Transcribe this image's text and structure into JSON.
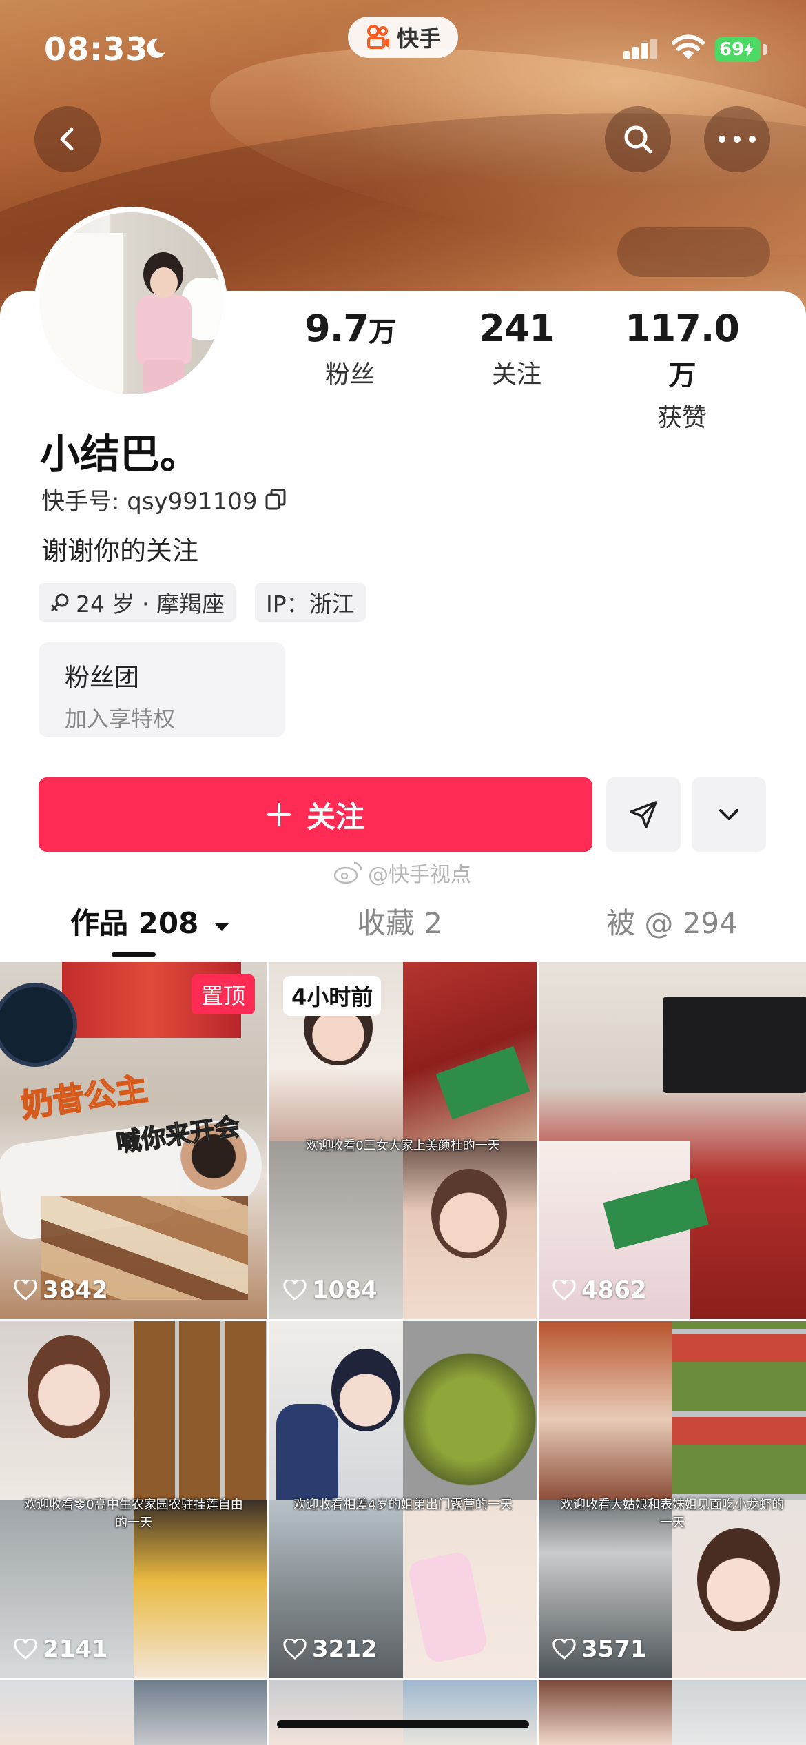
{
  "status_bar": {
    "time": "08:33",
    "app_name": "快手",
    "battery": "69"
  },
  "profile": {
    "name": "小结巴。",
    "kuaishou_id": "快手号: qsy991109",
    "bio": "谢谢你的关注",
    "tags": [
      "24 岁 · 摩羯座",
      "IP：浙江"
    ],
    "stats": [
      {
        "value": "9.7",
        "unit": "万",
        "label": "粉丝"
      },
      {
        "value": "241",
        "unit": "",
        "label": "关注"
      },
      {
        "value": "117.0",
        "unit": "万",
        "label": "获赞"
      }
    ],
    "fan_club": {
      "title": "粉丝团",
      "subtitle": "加入享特权"
    }
  },
  "actions": {
    "follow_label": "关注",
    "follow_icon": "plus-icon",
    "share_icon": "send-icon",
    "more_icon": "chevron-down-icon"
  },
  "watermark": "@快手视点",
  "tabs": [
    {
      "label": "作品 208",
      "active": true
    },
    {
      "label": "收藏 2",
      "active": false
    },
    {
      "label": "被 @ 294",
      "active": false
    }
  ],
  "videos": [
    {
      "likes": "3842",
      "badge": "置顶",
      "overlay_title": "奶昔公主",
      "overlay_sub": "喊你来开会",
      "caption": ""
    },
    {
      "likes": "1084",
      "badge": "4小时前",
      "caption": "欢迎收看0三女大家上美颜杜的一天"
    },
    {
      "likes": "4862",
      "caption": ""
    },
    {
      "likes": "2141",
      "caption": "欢迎收看零0高中生农家园农驻挂莲自由的一天"
    },
    {
      "likes": "3212",
      "caption": "欢迎收看相差4岁的姐弟出门露营的一天"
    },
    {
      "likes": "3571",
      "caption": "欢迎收看大姑娘和表妹姐见面吃小龙虾的一天"
    }
  ],
  "colors": {
    "accent": "#fe2c55",
    "banner": "#b4683a"
  }
}
